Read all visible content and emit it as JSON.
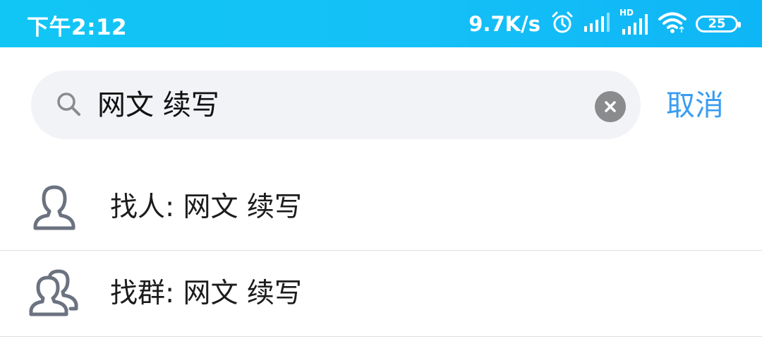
{
  "status_bar": {
    "time": "下午2:12",
    "net_speed": "9.7K/s",
    "network_badge": "HD",
    "battery_level": "25",
    "icons": [
      "alarm-icon",
      "signal-icon",
      "hd-signal-icon",
      "wifi-icon",
      "battery-icon"
    ]
  },
  "search": {
    "query": "网文 续写",
    "cancel_label": "取消",
    "icons": [
      "search-icon",
      "clear-icon"
    ]
  },
  "results": [
    {
      "label": "找人: 网文 续写",
      "icon": "person-icon"
    },
    {
      "label": "找群: 网文 续写",
      "icon": "group-icon"
    }
  ],
  "colors": {
    "status_bar": "#14c0f7",
    "accent": "#3a9df0",
    "search_bg": "#f2f3f7",
    "icon_gray": "#6b7280"
  }
}
